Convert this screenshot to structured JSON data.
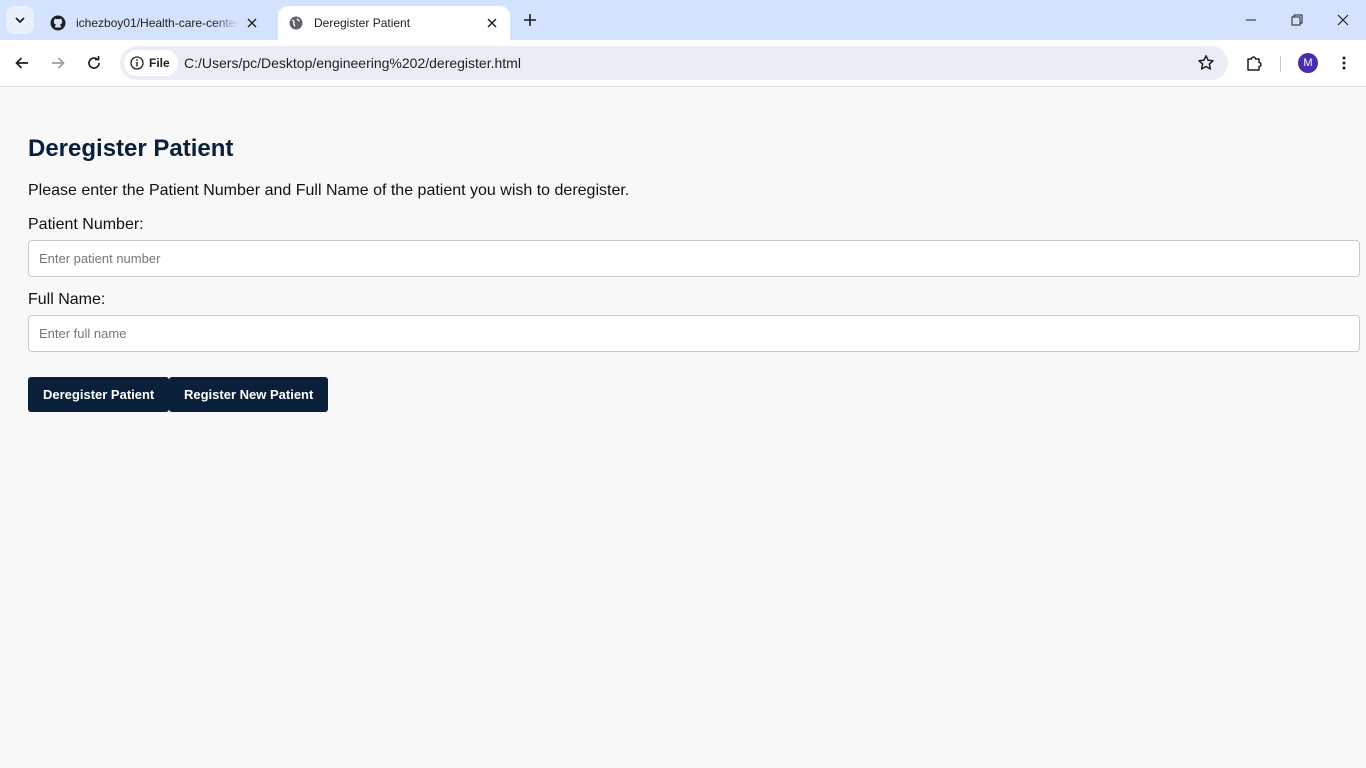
{
  "browser": {
    "tabs": [
      {
        "title": "ichezboy01/Health-care-center",
        "favicon": "github-icon",
        "active": false
      },
      {
        "title": "Deregister Patient",
        "favicon": "globe-icon",
        "active": true
      }
    ],
    "address_bar": {
      "chip_label": "File",
      "url": "C:/Users/pc/Desktop/engineering%202/deregister.html"
    },
    "profile_initial": "M",
    "profile_color": "#4a2cb0",
    "tabstrip_color": "#d3e3fd"
  },
  "page": {
    "title": "Deregister Patient",
    "intro": "Please enter the Patient Number and Full Name of the patient you wish to deregister.",
    "fields": {
      "patient_number": {
        "label": "Patient Number:",
        "placeholder": "Enter patient number",
        "value": ""
      },
      "full_name": {
        "label": "Full Name:",
        "placeholder": "Enter full name",
        "value": ""
      }
    },
    "buttons": {
      "deregister": "Deregister Patient",
      "register_new": "Register New Patient"
    },
    "accent_color": "#0a1f3a",
    "background_color": "#f8f8f8"
  }
}
